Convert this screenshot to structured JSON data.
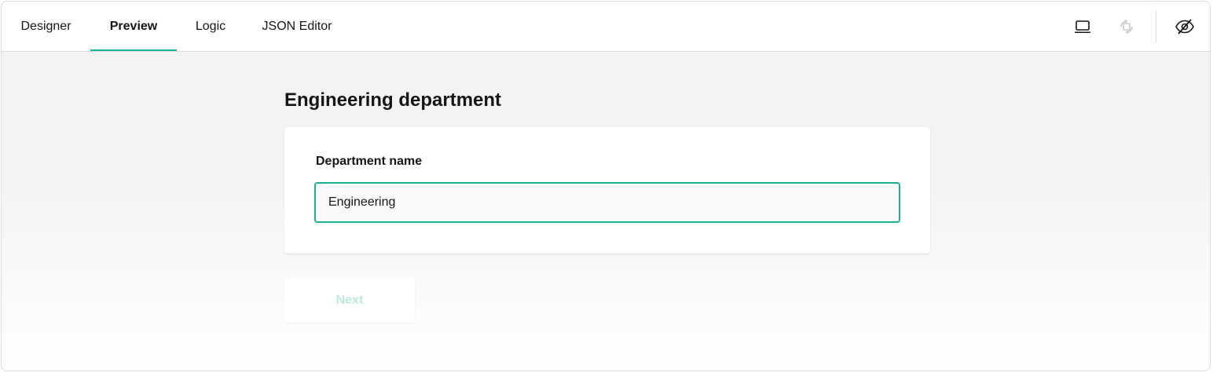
{
  "tabs": [
    {
      "label": "Designer",
      "active": false
    },
    {
      "label": "Preview",
      "active": true
    },
    {
      "label": "Logic",
      "active": false
    },
    {
      "label": "JSON Editor",
      "active": false
    }
  ],
  "toolbar": {
    "device_icon": "laptop-icon",
    "orientation_icon": "rotate-orientation-icon",
    "visibility_icon": "eye-off-icon"
  },
  "survey": {
    "title": "Engineering department",
    "question_title": "Department name",
    "input_value": "Engineering",
    "next_label": "Next"
  },
  "colors": {
    "accent": "#19b394",
    "next_disabled_text": "#bfe9df",
    "background": "#f3f3f3"
  }
}
